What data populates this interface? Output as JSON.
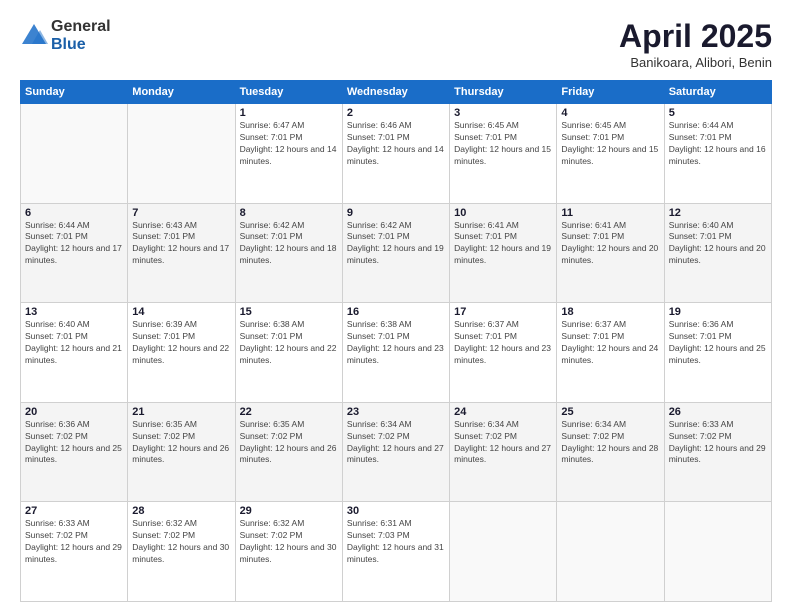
{
  "header": {
    "logo_general": "General",
    "logo_blue": "Blue",
    "month_title": "April 2025",
    "location": "Banikoara, Alibori, Benin"
  },
  "days_of_week": [
    "Sunday",
    "Monday",
    "Tuesday",
    "Wednesday",
    "Thursday",
    "Friday",
    "Saturday"
  ],
  "weeks": [
    [
      {
        "day": "",
        "info": ""
      },
      {
        "day": "",
        "info": ""
      },
      {
        "day": "1",
        "info": "Sunrise: 6:47 AM\nSunset: 7:01 PM\nDaylight: 12 hours and 14 minutes."
      },
      {
        "day": "2",
        "info": "Sunrise: 6:46 AM\nSunset: 7:01 PM\nDaylight: 12 hours and 14 minutes."
      },
      {
        "day": "3",
        "info": "Sunrise: 6:45 AM\nSunset: 7:01 PM\nDaylight: 12 hours and 15 minutes."
      },
      {
        "day": "4",
        "info": "Sunrise: 6:45 AM\nSunset: 7:01 PM\nDaylight: 12 hours and 15 minutes."
      },
      {
        "day": "5",
        "info": "Sunrise: 6:44 AM\nSunset: 7:01 PM\nDaylight: 12 hours and 16 minutes."
      }
    ],
    [
      {
        "day": "6",
        "info": "Sunrise: 6:44 AM\nSunset: 7:01 PM\nDaylight: 12 hours and 17 minutes."
      },
      {
        "day": "7",
        "info": "Sunrise: 6:43 AM\nSunset: 7:01 PM\nDaylight: 12 hours and 17 minutes."
      },
      {
        "day": "8",
        "info": "Sunrise: 6:42 AM\nSunset: 7:01 PM\nDaylight: 12 hours and 18 minutes."
      },
      {
        "day": "9",
        "info": "Sunrise: 6:42 AM\nSunset: 7:01 PM\nDaylight: 12 hours and 19 minutes."
      },
      {
        "day": "10",
        "info": "Sunrise: 6:41 AM\nSunset: 7:01 PM\nDaylight: 12 hours and 19 minutes."
      },
      {
        "day": "11",
        "info": "Sunrise: 6:41 AM\nSunset: 7:01 PM\nDaylight: 12 hours and 20 minutes."
      },
      {
        "day": "12",
        "info": "Sunrise: 6:40 AM\nSunset: 7:01 PM\nDaylight: 12 hours and 20 minutes."
      }
    ],
    [
      {
        "day": "13",
        "info": "Sunrise: 6:40 AM\nSunset: 7:01 PM\nDaylight: 12 hours and 21 minutes."
      },
      {
        "day": "14",
        "info": "Sunrise: 6:39 AM\nSunset: 7:01 PM\nDaylight: 12 hours and 22 minutes."
      },
      {
        "day": "15",
        "info": "Sunrise: 6:38 AM\nSunset: 7:01 PM\nDaylight: 12 hours and 22 minutes."
      },
      {
        "day": "16",
        "info": "Sunrise: 6:38 AM\nSunset: 7:01 PM\nDaylight: 12 hours and 23 minutes."
      },
      {
        "day": "17",
        "info": "Sunrise: 6:37 AM\nSunset: 7:01 PM\nDaylight: 12 hours and 23 minutes."
      },
      {
        "day": "18",
        "info": "Sunrise: 6:37 AM\nSunset: 7:01 PM\nDaylight: 12 hours and 24 minutes."
      },
      {
        "day": "19",
        "info": "Sunrise: 6:36 AM\nSunset: 7:01 PM\nDaylight: 12 hours and 25 minutes."
      }
    ],
    [
      {
        "day": "20",
        "info": "Sunrise: 6:36 AM\nSunset: 7:02 PM\nDaylight: 12 hours and 25 minutes."
      },
      {
        "day": "21",
        "info": "Sunrise: 6:35 AM\nSunset: 7:02 PM\nDaylight: 12 hours and 26 minutes."
      },
      {
        "day": "22",
        "info": "Sunrise: 6:35 AM\nSunset: 7:02 PM\nDaylight: 12 hours and 26 minutes."
      },
      {
        "day": "23",
        "info": "Sunrise: 6:34 AM\nSunset: 7:02 PM\nDaylight: 12 hours and 27 minutes."
      },
      {
        "day": "24",
        "info": "Sunrise: 6:34 AM\nSunset: 7:02 PM\nDaylight: 12 hours and 27 minutes."
      },
      {
        "day": "25",
        "info": "Sunrise: 6:34 AM\nSunset: 7:02 PM\nDaylight: 12 hours and 28 minutes."
      },
      {
        "day": "26",
        "info": "Sunrise: 6:33 AM\nSunset: 7:02 PM\nDaylight: 12 hours and 29 minutes."
      }
    ],
    [
      {
        "day": "27",
        "info": "Sunrise: 6:33 AM\nSunset: 7:02 PM\nDaylight: 12 hours and 29 minutes."
      },
      {
        "day": "28",
        "info": "Sunrise: 6:32 AM\nSunset: 7:02 PM\nDaylight: 12 hours and 30 minutes."
      },
      {
        "day": "29",
        "info": "Sunrise: 6:32 AM\nSunset: 7:02 PM\nDaylight: 12 hours and 30 minutes."
      },
      {
        "day": "30",
        "info": "Sunrise: 6:31 AM\nSunset: 7:03 PM\nDaylight: 12 hours and 31 minutes."
      },
      {
        "day": "",
        "info": ""
      },
      {
        "day": "",
        "info": ""
      },
      {
        "day": "",
        "info": ""
      }
    ]
  ]
}
